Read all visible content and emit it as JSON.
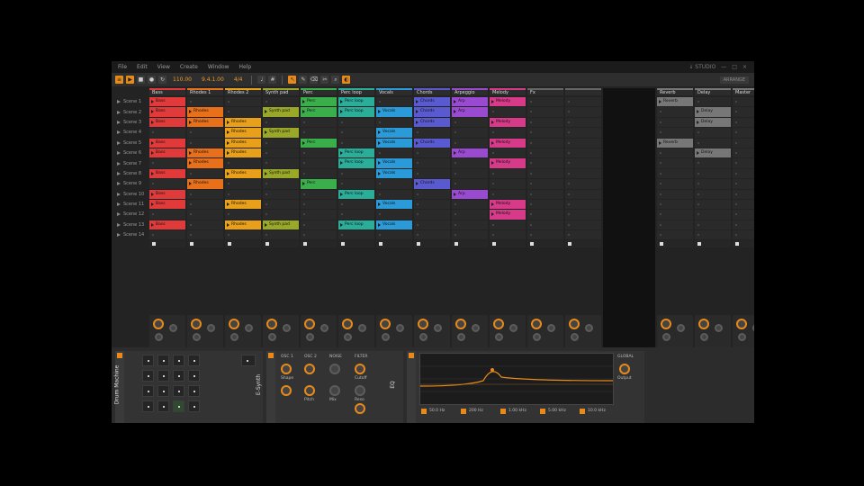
{
  "menu": [
    "File",
    "Edit",
    "View",
    "Create",
    "Window",
    "Help"
  ],
  "menu_right": [
    "↓ STUDIO",
    "—",
    "□",
    "×"
  ],
  "transport": {
    "tempo": "110.00",
    "position": "9.4.1.00",
    "signature": "4/4",
    "tb_right": "ARRANGE"
  },
  "scenes": [
    "Scene 1",
    "Scene 2",
    "Scene 3",
    "Scene 4",
    "Scene 5",
    "Scene 6",
    "Scene 7",
    "Scene 8",
    "Scene 9",
    "Scene 10",
    "Scene 11",
    "Scene 12",
    "Scene 13",
    "Scene 14"
  ],
  "tracks": [
    {
      "name": "Bass",
      "color": "#e03a3a",
      "clips": [
        "Bass",
        "Bass",
        "Bass",
        "",
        "Bass",
        "Bass",
        "",
        "Bass",
        "",
        "Bass",
        "Bass",
        "",
        "Bass",
        ""
      ]
    },
    {
      "name": "Rhodes 1",
      "color": "#e8701a",
      "clips": [
        "",
        "Rhodes",
        "Rhodes",
        "",
        "",
        "Rhodes",
        "Rhodes",
        "",
        "Rhodes",
        "",
        "",
        "",
        "",
        ""
      ]
    },
    {
      "name": "Rhodes 2",
      "color": "#e8a01a",
      "clips": [
        "",
        "",
        "Rhodes",
        "Rhodes",
        "Rhodes",
        "Rhodes",
        "",
        "Rhodes",
        "",
        "",
        "Rhodes",
        "",
        "Rhodes",
        ""
      ]
    },
    {
      "name": "Synth pad",
      "color": "#9aa82a",
      "clips": [
        "",
        "Synth pad",
        "",
        "Synth pad",
        "",
        "",
        "",
        "Synth pad",
        "",
        "",
        "",
        "",
        "Synth pad",
        ""
      ]
    },
    {
      "name": "Perc",
      "color": "#3aae4a",
      "clips": [
        "Perc",
        "Perc",
        "",
        "",
        "Perc",
        "",
        "",
        "",
        "Perc",
        "",
        "",
        "",
        "",
        ""
      ]
    },
    {
      "name": "Perc loop",
      "color": "#2aae9a",
      "clips": [
        "Perc loop",
        "Perc loop",
        "",
        "",
        "",
        "Perc loop",
        "Perc loop",
        "",
        "",
        "Perc loop",
        "",
        "",
        "Perc loop",
        ""
      ]
    },
    {
      "name": "Vocals",
      "color": "#2a9ad8",
      "clips": [
        "",
        "Vocals",
        "",
        "Vocals",
        "Vocals",
        "",
        "Vocals",
        "Vocals",
        "",
        "",
        "Vocals",
        "",
        "Vocals",
        ""
      ]
    },
    {
      "name": "Chords",
      "color": "#5a5ad0",
      "clips": [
        "Chords",
        "Chords",
        "Chords",
        "",
        "Chords",
        "",
        "",
        "",
        "Chords",
        "",
        "",
        "",
        "",
        ""
      ]
    },
    {
      "name": "Arpeggio",
      "color": "#9a4ad0",
      "clips": [
        "Arp",
        "Arp",
        "",
        "",
        "",
        "Arp",
        "",
        "",
        "",
        "Arp",
        "",
        "",
        "",
        ""
      ]
    },
    {
      "name": "Melody",
      "color": "#d83a8a",
      "clips": [
        "Melody",
        "",
        "Melody",
        "",
        "Melody",
        "",
        "Melody",
        "",
        "",
        "",
        "Melody",
        "Melody",
        "",
        ""
      ]
    },
    {
      "name": "Fx",
      "color": "#666",
      "clips": [
        "",
        "",
        "",
        "",
        "",
        "",
        "",
        "",
        "",
        "",
        "",
        "",
        "",
        ""
      ]
    },
    {
      "name": "",
      "color": "#666",
      "clips": [
        "",
        "",
        "",
        "",
        "",
        "",
        "",
        "",
        "",
        "",
        "",
        "",
        "",
        ""
      ]
    }
  ],
  "returns": [
    {
      "name": "Reverb",
      "color": "#777",
      "clips": [
        "Reverb",
        "",
        "",
        "",
        "Reverb",
        "",
        "",
        "",
        "",
        "",
        "",
        "",
        "",
        ""
      ]
    },
    {
      "name": "Delay",
      "color": "#777",
      "clips": [
        "",
        "Delay",
        "Delay",
        "",
        "",
        "Delay",
        "",
        "",
        "",
        "",
        "",
        "",
        "",
        ""
      ]
    },
    {
      "name": "Master",
      "color": "#777",
      "clips": [
        "",
        "",
        "",
        "",
        "",
        "",
        "",
        "",
        "",
        "",
        "",
        "",
        "",
        ""
      ]
    }
  ],
  "devices": {
    "drum_machine": "Drum Machine",
    "synth": "E-Synth",
    "synth_labels": [
      "OSC 1",
      "OSC 2",
      "NOISE",
      "FILTER",
      "Shape",
      "Pitch",
      "Cutoff",
      "Reso",
      "Mix"
    ],
    "eq": "EQ",
    "eq_labels": [
      "GLOBAL",
      "Output"
    ],
    "eq_bands": [
      "50.0 Hz",
      "200 Hz",
      "1.00 kHz",
      "5.00 kHz",
      "10.0 kHz"
    ]
  },
  "accent_color": "#e88a1a",
  "meter_color": "#c6d42a"
}
